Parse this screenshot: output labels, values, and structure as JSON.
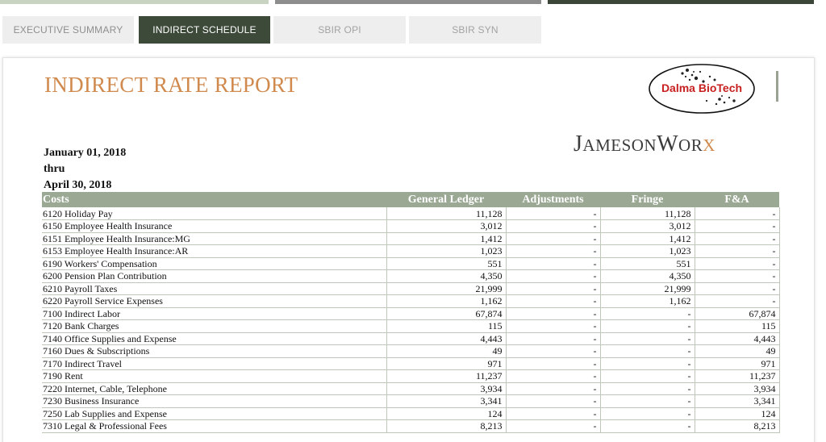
{
  "colors": {
    "accent_dark": "#3d4a3a",
    "title_orange": "#d08a4e",
    "table_header": "#9aa894",
    "tab_inactive": "#eeeeee"
  },
  "tabs": [
    {
      "label": "EXECUTIVE SUMMARY",
      "active": false
    },
    {
      "label": "INDIRECT SCHEDULE",
      "active": true
    },
    {
      "label": "SBIR OPI",
      "active": false
    },
    {
      "label": "SBIR SYN",
      "active": false
    }
  ],
  "report": {
    "title": "INDIRECT RATE REPORT",
    "start_date": "January 01, 2018",
    "thru": "thru",
    "end_date": "April 30, 2018"
  },
  "logos": {
    "client_logo_text": "Dalma BioTech",
    "firm_logo": {
      "j": "J",
      "ameson": "AMESON",
      "w": "W",
      "or": "OR",
      "x": "X"
    }
  },
  "table": {
    "headers": [
      "Costs",
      "General Ledger",
      "Adjustments",
      "Fringe",
      "F&A"
    ],
    "rows": [
      [
        "6120 Holiday Pay",
        "11,128",
        "-",
        "11,128",
        "-"
      ],
      [
        "6150 Employee Health Insurance",
        "3,012",
        "-",
        "3,012",
        "-"
      ],
      [
        "6151 Employee Health Insurance:MG",
        "1,412",
        "-",
        "1,412",
        "-"
      ],
      [
        "6153 Employee Health Insurance:AR",
        "1,023",
        "-",
        "1,023",
        "-"
      ],
      [
        "6190 Workers' Compensation",
        "551",
        "-",
        "551",
        "-"
      ],
      [
        "6200 Pension Plan Contribution",
        "4,350",
        "-",
        "4,350",
        "-"
      ],
      [
        "6210 Payroll Taxes",
        "21,999",
        "-",
        "21,999",
        "-"
      ],
      [
        "6220 Payroll Service Expenses",
        "1,162",
        "-",
        "1,162",
        "-"
      ],
      [
        "7100 Indirect Labor",
        "67,874",
        "-",
        "-",
        "67,874"
      ],
      [
        "7120 Bank Charges",
        "115",
        "-",
        "-",
        "115"
      ],
      [
        "7140 Office Supplies and Expense",
        "4,443",
        "-",
        "-",
        "4,443"
      ],
      [
        "7160 Dues & Subscriptions",
        "49",
        "-",
        "-",
        "49"
      ],
      [
        "7170 Indirect Travel",
        "971",
        "-",
        "-",
        "971"
      ],
      [
        "7190 Rent",
        "11,237",
        "-",
        "-",
        "11,237"
      ],
      [
        "7220 Internet, Cable, Telephone",
        "3,934",
        "-",
        "-",
        "3,934"
      ],
      [
        "7230 Business Insurance",
        "3,341",
        "-",
        "-",
        "3,341"
      ],
      [
        "7250 Lab Supplies and Expense",
        "124",
        "-",
        "-",
        "124"
      ],
      [
        "7310 Legal & Professional Fees",
        "8,213",
        "-",
        "-",
        "8,213"
      ]
    ]
  }
}
